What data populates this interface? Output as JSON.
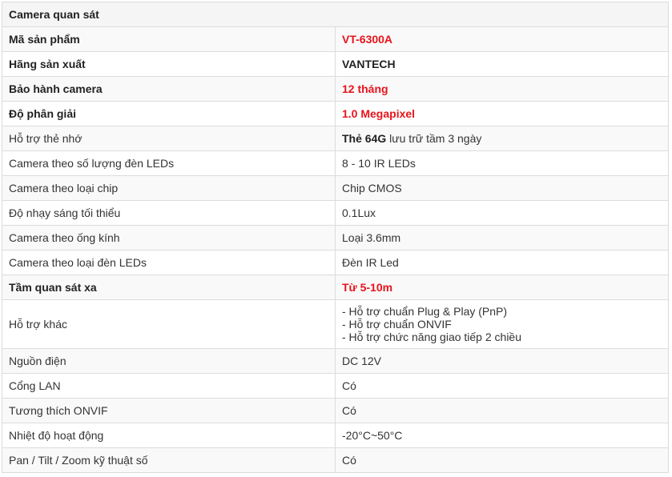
{
  "header": "Camera quan sát",
  "rows": [
    {
      "label": "Mã sản phẩm",
      "value": "VT-6300A"
    },
    {
      "label": "Hãng sản xuất",
      "value": "VANTECH"
    },
    {
      "label": "Bảo hành camera",
      "value": "12 tháng"
    },
    {
      "label": "Độ phân giải",
      "value": "1.0 Megapixel"
    },
    {
      "label": "Hỗ trợ thẻ nhớ",
      "value_bold": "Thẻ 64G",
      "value_rest": " lưu trữ tầm 3 ngày"
    },
    {
      "label": "Camera theo số lượng đèn LEDs",
      "value": "8 - 10 IR LEDs"
    },
    {
      "label": "Camera theo loại chip",
      "value": "Chip CMOS"
    },
    {
      "label": "Độ nhạy sáng tối thiểu",
      "value": "0.1Lux"
    },
    {
      "label": "Camera theo ống kính",
      "value": "Loại 3.6mm"
    },
    {
      "label": "Camera theo loại đèn LEDs",
      "value": "Đèn IR Led"
    },
    {
      "label": "Tầm quan sát xa",
      "value": "Từ 5-10m"
    },
    {
      "label": "Hỗ trợ khác",
      "lines": [
        "- Hỗ trợ chuẩn Plug & Play (PnP)",
        "- Hỗ trợ chuẩn ONVIF",
        "- Hỗ trợ chức năng giao tiếp 2 chiều"
      ]
    },
    {
      "label": "Nguồn điện",
      "value": "DC 12V"
    },
    {
      "label": "Cổng LAN",
      "value": "Có"
    },
    {
      "label": "Tương thích ONVIF",
      "value": "Có"
    },
    {
      "label": "Nhiệt độ hoạt động",
      "value": "-20°C~50°C"
    },
    {
      "label": "Pan / Tilt / Zoom kỹ thuật số",
      "value": "Có"
    }
  ],
  "colors": {
    "accent_red": "#e8141b",
    "header_bg": "#f5f5f5",
    "border": "#dcdcdc"
  }
}
